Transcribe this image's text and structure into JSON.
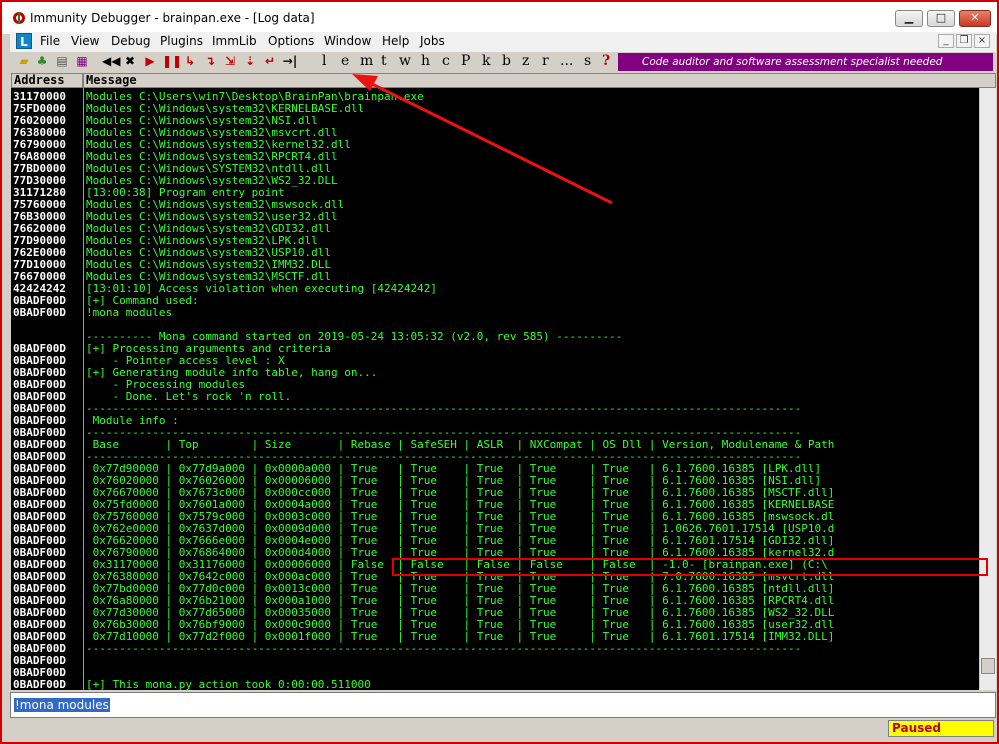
{
  "window": {
    "title": "Immunity Debugger - brainpan.exe - [Log data]"
  },
  "menu": [
    "File",
    "View",
    "Debug",
    "Plugins",
    "ImmLib",
    "Options",
    "Window",
    "Help",
    "Jobs"
  ],
  "toolbar": {
    "letters": [
      "l",
      "e",
      "m",
      "t",
      "w",
      "h",
      "c",
      "P",
      "k",
      "b",
      "z",
      "r",
      "...",
      "s",
      "?"
    ],
    "banner": "Code auditor and software assessment specialist needed"
  },
  "log": {
    "headers": {
      "address": "Address",
      "message": "Message"
    },
    "rows": [
      {
        "addr": "31170000",
        "msg": "Modules C:\\Users\\win7\\Desktop\\BrainPan\\brainpan.exe"
      },
      {
        "addr": "75FD0000",
        "msg": "Modules C:\\Windows\\system32\\KERNELBASE.dll"
      },
      {
        "addr": "76020000",
        "msg": "Modules C:\\Windows\\system32\\NSI.dll"
      },
      {
        "addr": "76380000",
        "msg": "Modules C:\\Windows\\system32\\msvcrt.dll"
      },
      {
        "addr": "76790000",
        "msg": "Modules C:\\Windows\\system32\\kernel32.dll"
      },
      {
        "addr": "76A80000",
        "msg": "Modules C:\\Windows\\system32\\RPCRT4.dll"
      },
      {
        "addr": "77BD0000",
        "msg": "Modules C:\\Windows\\SYSTEM32\\ntdll.dll"
      },
      {
        "addr": "77D30000",
        "msg": "Modules C:\\Windows\\system32\\WS2_32.DLL"
      },
      {
        "addr": "31171280",
        "msg": "[13:00:38] Program entry point"
      },
      {
        "addr": "75760000",
        "msg": "Modules C:\\Windows\\system32\\mswsock.dll"
      },
      {
        "addr": "76B30000",
        "msg": "Modules C:\\Windows\\system32\\user32.dll"
      },
      {
        "addr": "76620000",
        "msg": "Modules C:\\Windows\\system32\\GDI32.dll"
      },
      {
        "addr": "77D90000",
        "msg": "Modules C:\\Windows\\system32\\LPK.dll"
      },
      {
        "addr": "762E0000",
        "msg": "Modules C:\\Windows\\system32\\USP10.dll"
      },
      {
        "addr": "77D10000",
        "msg": "Modules C:\\Windows\\system32\\IMM32.DLL"
      },
      {
        "addr": "76670000",
        "msg": "Modules C:\\Windows\\system32\\MSCTF.dll"
      },
      {
        "addr": "42424242",
        "msg": "[13:01:10] Access violation when executing [42424242]"
      },
      {
        "addr": "0BADF00D",
        "msg": "[+] Command used:"
      },
      {
        "addr": "0BADF00D",
        "msg": "!mona modules"
      },
      {
        "addr": "",
        "msg": ""
      },
      {
        "addr": "",
        "msg": "---------- Mona command started on 2019-05-24 13:05:32 (v2.0, rev 585) ----------"
      },
      {
        "addr": "0BADF00D",
        "msg": "[+] Processing arguments and criteria"
      },
      {
        "addr": "0BADF00D",
        "msg": "    - Pointer access level : X"
      },
      {
        "addr": "0BADF00D",
        "msg": "[+] Generating module info table, hang on..."
      },
      {
        "addr": "0BADF00D",
        "msg": "    - Processing modules"
      },
      {
        "addr": "0BADF00D",
        "msg": "    - Done. Let's rock 'n roll."
      },
      {
        "addr": "0BADF00D",
        "msg": "------------------------------------------------------------------------------------------------------------"
      },
      {
        "addr": "0BADF00D",
        "msg": " Module info :"
      },
      {
        "addr": "0BADF00D",
        "msg": "------------------------------------------------------------------------------------------------------------"
      },
      {
        "addr": "0BADF00D",
        "msg": " Base       | Top        | Size       | Rebase | SafeSEH | ASLR  | NXCompat | OS Dll | Version, Modulename & Path"
      },
      {
        "addr": "0BADF00D",
        "msg": "------------------------------------------------------------------------------------------------------------"
      },
      {
        "addr": "0BADF00D",
        "msg": " 0x77d90000 | 0x77d9a000 | 0x0000a000 | True   | True    | True  | True     | True   | 6.1.7600.16385 [LPK.dll]"
      },
      {
        "addr": "0BADF00D",
        "msg": " 0x76020000 | 0x76026000 | 0x00006000 | True   | True    | True  | True     | True   | 6.1.7600.16385 [NSI.dll]"
      },
      {
        "addr": "0BADF00D",
        "msg": " 0x76670000 | 0x7673c000 | 0x000cc000 | True   | True    | True  | True     | True   | 6.1.7600.16385 [MSCTF.dll]"
      },
      {
        "addr": "0BADF00D",
        "msg": " 0x75fd0000 | 0x7601a000 | 0x0004a000 | True   | True    | True  | True     | True   | 6.1.7600.16385 [KERNELBASE"
      },
      {
        "addr": "0BADF00D",
        "msg": " 0x75760000 | 0x7579c000 | 0x0003c000 | True   | True    | True  | True     | True   | 6.1.7600.16385 [mswsock.dl"
      },
      {
        "addr": "0BADF00D",
        "msg": " 0x762e0000 | 0x7637d000 | 0x0009d000 | True   | True    | True  | True     | True   | 1.0626.7601.17514 [USP10.d"
      },
      {
        "addr": "0BADF00D",
        "msg": " 0x76620000 | 0x7666e000 | 0x0004e000 | True   | True    | True  | True     | True   | 6.1.7601.17514 [GDI32.dll]"
      },
      {
        "addr": "0BADF00D",
        "msg": " 0x76790000 | 0x76864000 | 0x000d4000 | True   | True    | True  | True     | True   | 6.1.7600.16385 [kernel32.d"
      },
      {
        "addr": "0BADF00D",
        "msg": " 0x31170000 | 0x31176000 | 0x00006000 | False  | False   | False | False    | False  | -1.0- [brainpan.exe] (C:\\"
      },
      {
        "addr": "0BADF00D",
        "msg": " 0x76380000 | 0x7642c000 | 0x000ac000 | True   | True    | True  | True     | True   | 7.0.7600.16385 [msvcrt.dll"
      },
      {
        "addr": "0BADF00D",
        "msg": " 0x77bd0000 | 0x77d0c000 | 0x0013c000 | True   | True    | True  | True     | True   | 6.1.7600.16385 [ntdll.dll]"
      },
      {
        "addr": "0BADF00D",
        "msg": " 0x76a80000 | 0x76b21000 | 0x000a1000 | True   | True    | True  | True     | True   | 6.1.7600.16385 [RPCRT4.dll"
      },
      {
        "addr": "0BADF00D",
        "msg": " 0x77d30000 | 0x77d65000 | 0x00035000 | True   | True    | True  | True     | True   | 6.1.7600.16385 [WS2_32.DLL"
      },
      {
        "addr": "0BADF00D",
        "msg": " 0x76b30000 | 0x76bf9000 | 0x000c9000 | True   | True    | True  | True     | True   | 6.1.7600.16385 [user32.dll"
      },
      {
        "addr": "0BADF00D",
        "msg": " 0x77d10000 | 0x77d2f000 | 0x0001f000 | True   | True    | True  | True     | True   | 6.1.7601.17514 [IMM32.DLL]"
      },
      {
        "addr": "0BADF00D",
        "msg": "------------------------------------------------------------------------------------------------------------"
      },
      {
        "addr": "0BADF00D",
        "msg": ""
      },
      {
        "addr": "0BADF00D",
        "msg": ""
      },
      {
        "addr": "0BADF00D",
        "msg": "[+] This mona.py action took 0:00:00.511000"
      }
    ]
  },
  "command": {
    "value": "!mona modules"
  },
  "status": {
    "state": "Paused"
  },
  "colors": {
    "log_text": "#33ff33",
    "banner_bg": "#800080",
    "paused_bg": "#ffff00",
    "annotation": "#e00000"
  }
}
